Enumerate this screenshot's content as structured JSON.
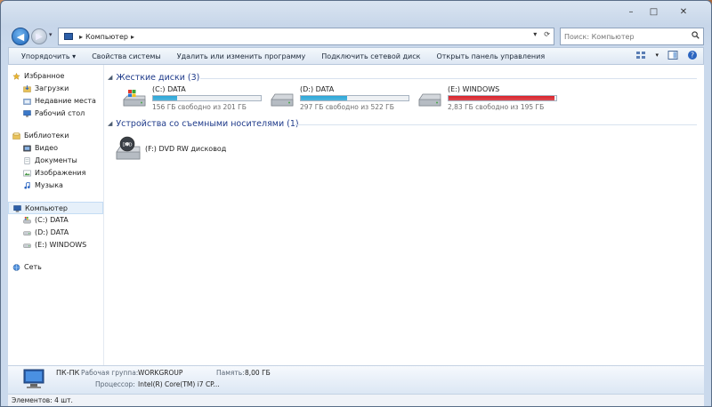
{
  "window": {
    "title": "Компьютер"
  },
  "caption": {
    "minimize": "–",
    "maximize": "□",
    "close": "✕"
  },
  "address": {
    "path": "Компьютер",
    "separator": "▸"
  },
  "search": {
    "placeholder": "Поиск: Компьютер"
  },
  "toolbar": {
    "organize": "Упорядочить ▾",
    "items": [
      "Свойства системы",
      "Удалить или изменить программу",
      "Подключить сетевой диск",
      "Открыть панель управления"
    ]
  },
  "nav": {
    "favorites": {
      "title": "Избранное",
      "items": [
        "Загрузки",
        "Недавние места",
        "Рабочий стол"
      ]
    },
    "libraries": {
      "title": "Библиотеки",
      "items": [
        "Видео",
        "Документы",
        "Изображения",
        "Музыка"
      ]
    },
    "computer": {
      "title": "Компьютер",
      "items": [
        "(C:) DATA",
        "(D:) DATA",
        "(E:) WINDOWS"
      ]
    },
    "network": {
      "title": "Сеть"
    }
  },
  "groups": {
    "hard_disks": "Жесткие диски (3)",
    "removable": "Устройства со съемными носителями (1)"
  },
  "drives": [
    {
      "name": "(C:) DATA",
      "free": "156 ГБ свободно из 201 ГБ",
      "used_fraction": 0.22,
      "color": "#2aa7d8"
    },
    {
      "name": "(D:) DATA",
      "free": "297 ГБ свободно из 522 ГБ",
      "used_fraction": 0.43,
      "color": "#2aa7d8"
    },
    {
      "name": "(E:) WINDOWS",
      "free": "2,83 ГБ свободно из 195 ГБ",
      "used_fraction": 0.985,
      "color": "#d9222a"
    }
  ],
  "dvd": {
    "name": "(F:) DVD RW дисковод",
    "label": "DVD"
  },
  "details": {
    "pc_name": "ПК-ПК",
    "workgroup_label": "Рабочая группа:",
    "workgroup": "WORKGROUP",
    "memory_label": "Память:",
    "memory": "8,00 ГБ",
    "cpu_label": "Процессор:",
    "cpu": "Intel(R) Core(TM) i7 CP..."
  },
  "status": {
    "items": "Элементов: 4 шт."
  }
}
